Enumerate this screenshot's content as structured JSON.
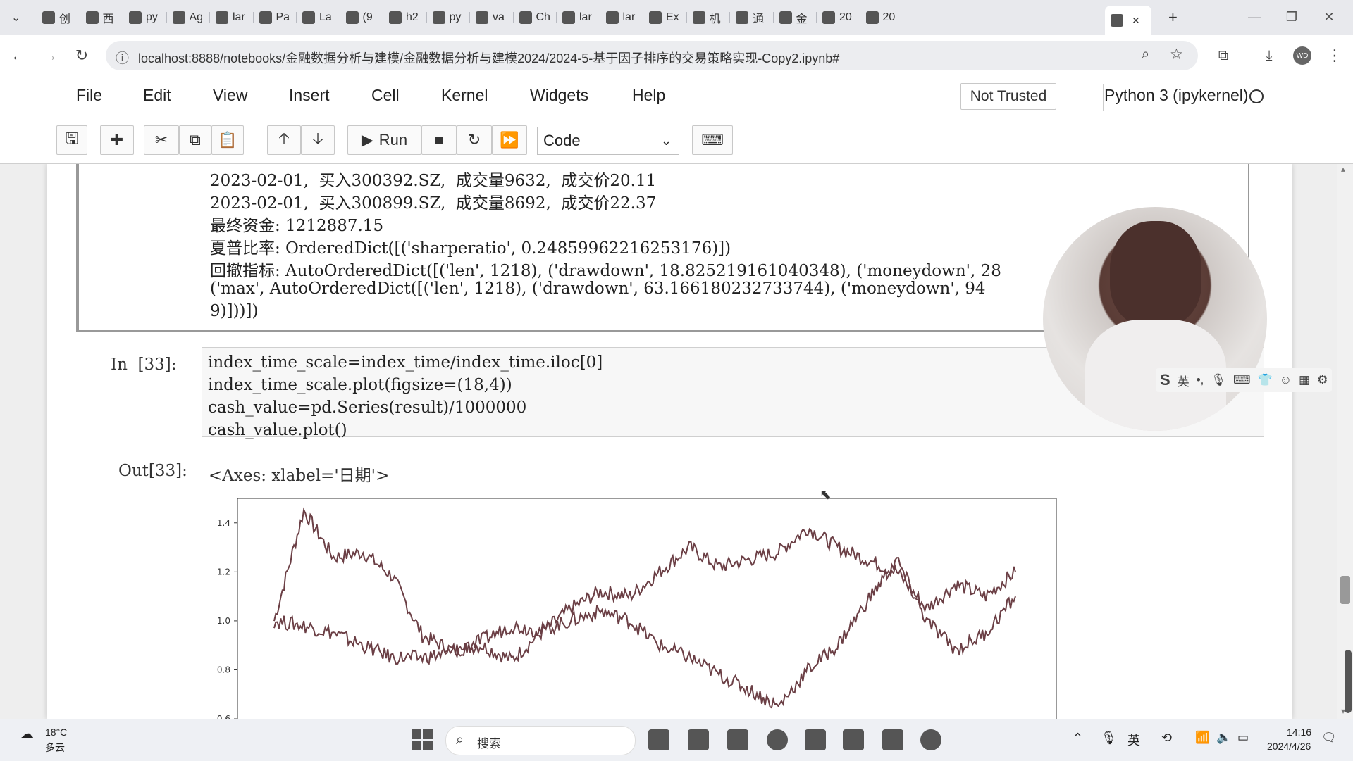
{
  "browser": {
    "tabs": [
      {
        "label": "创",
        "icon": "bilibili-icon"
      },
      {
        "label": "西",
        "icon": "gear-icon"
      },
      {
        "label": "py",
        "icon": "github-icon"
      },
      {
        "label": "Ag",
        "icon": "mail-icon"
      },
      {
        "label": "lar",
        "icon": "github-icon"
      },
      {
        "label": "Pa",
        "icon": "mail-icon"
      },
      {
        "label": "La",
        "icon": "mail-icon"
      },
      {
        "label": "(9",
        "icon": "app-icon"
      },
      {
        "label": "h2",
        "icon": "github-icon"
      },
      {
        "label": "py",
        "icon": "c-icon"
      },
      {
        "label": "va",
        "icon": "github-icon"
      },
      {
        "label": "Ch",
        "icon": "mail-icon"
      },
      {
        "label": "lar",
        "icon": "book-icon"
      },
      {
        "label": "lar",
        "icon": "book-icon"
      },
      {
        "label": "Ex",
        "icon": "user-icon"
      },
      {
        "label": "机",
        "icon": "app-icon"
      },
      {
        "label": "通",
        "icon": "app-icon"
      },
      {
        "label": "金",
        "icon": "loading-icon"
      },
      {
        "label": "20",
        "icon": "notebook-icon"
      },
      {
        "label": "20",
        "icon": "notebook-icon"
      },
      {
        "label": "",
        "icon": "notebook-icon",
        "active": true
      }
    ],
    "url": "localhost:8888/notebooks/金融数据分析与建模/金融数据分析与建模2024/2024-5-基于因子排序的交易策略实现-Copy2.ipynb#",
    "profile_initials": "WD"
  },
  "jupyter": {
    "menu": [
      "File",
      "Edit",
      "View",
      "Insert",
      "Cell",
      "Kernel",
      "Widgets",
      "Help"
    ],
    "trusted_label": "Not Trusted",
    "kernel_name": "Python 3 (ipykernel)",
    "run_label": "Run",
    "cell_type": "Code"
  },
  "notebook": {
    "output_lines": [
      "2023-02-01,  买入300392.SZ,  成交量9632,  成交价20.11",
      "2023-02-01,  买入300899.SZ,  成交量8692,  成交价22.37",
      "最终资金: 1212887.15",
      "夏普比率: OrderedDict([('sharperatio', 0.24859962216253176)])",
      "回撤指标: AutoOrderedDict([('len', 1218), ('drawdown', 18.825219161040348), ('moneydown', 28",
      "('max', AutoOrderedDict([('len', 1218), ('drawdown', 63.166180232733744), ('moneydown', 94",
      "9)]))])"
    ],
    "in_prompt": "In  [33]:",
    "code_lines": [
      "index_time_scale=index_time/index_time.iloc[0]",
      "index_time_scale.plot(figsize=(18,4))",
      "cash_value=pd.Series(result)/1000000",
      "cash_value.plot()"
    ],
    "out_prompt": "Out[33]:",
    "out_text": "<Axes: xlabel='日期'>"
  },
  "chart_data": {
    "type": "line",
    "title": "",
    "xlabel": "",
    "ylabel": "",
    "ylim": [
      0.58,
      1.5
    ],
    "yticks": [
      "1.4",
      "1.2",
      "1.0",
      "0.8",
      "0.6"
    ],
    "ytick_values": [
      1.4,
      1.2,
      1.0,
      0.8,
      0.6
    ],
    "x": [
      0,
      4,
      8,
      12,
      16,
      20,
      24,
      28,
      32,
      36,
      40,
      44,
      48,
      52,
      56,
      60,
      64,
      68,
      72,
      76,
      80,
      84,
      88,
      92,
      96,
      100
    ],
    "series": [
      {
        "values": [
          1.0,
          1.45,
          1.26,
          1.28,
          1.18,
          0.94,
          0.88,
          0.9,
          0.84,
          0.95,
          1.05,
          1.12,
          1.1,
          1.2,
          1.3,
          1.22,
          1.25,
          1.28,
          1.38,
          1.3,
          1.25,
          1.2,
          1.05,
          1.15,
          1.1,
          1.2
        ]
      },
      {
        "values": [
          1.0,
          0.98,
          0.95,
          0.9,
          0.85,
          0.85,
          0.87,
          0.92,
          0.98,
          0.96,
          1.0,
          1.04,
          1.0,
          0.9,
          0.85,
          0.78,
          0.72,
          0.65,
          0.8,
          0.9,
          1.08,
          1.25,
          1.0,
          0.88,
          0.95,
          1.1
        ]
      }
    ],
    "line_color": "#6b3f45"
  },
  "taskbar": {
    "weather_temp": "18°C",
    "weather_desc": "多云",
    "search_placeholder": "搜索",
    "time": "14:16",
    "date": "2024/4/26",
    "ime_label": "英"
  }
}
